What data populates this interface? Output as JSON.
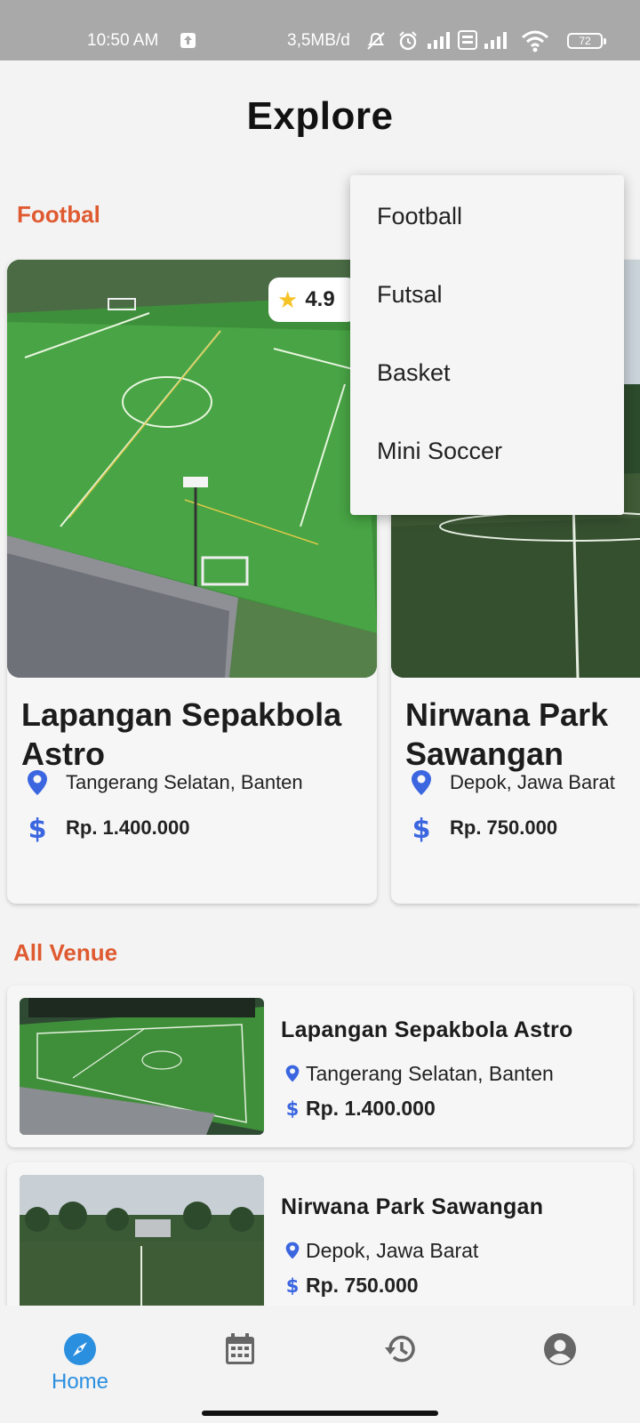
{
  "status_bar": {
    "time": "10:50 AM",
    "network_speed": "3,5MB/d",
    "battery": "72"
  },
  "header": {
    "title": "Explore"
  },
  "featured": {
    "section_label": "Footbal",
    "cards": [
      {
        "name": "Lapangan Sepakbola Astro",
        "rating": "4.9",
        "location": "Tangerang Selatan, Banten",
        "price": "Rp. 1.400.000"
      },
      {
        "name": "Nirwana Park Sawangan",
        "location": "Depok, Jawa Barat",
        "price": "Rp. 750.000"
      }
    ]
  },
  "all_venue": {
    "section_label": "All Venue",
    "items": [
      {
        "name": "Lapangan Sepakbola Astro",
        "location": "Tangerang Selatan, Banten",
        "price": "Rp. 1.400.000"
      },
      {
        "name": "Nirwana Park Sawangan",
        "location": "Depok, Jawa Barat",
        "price": "Rp. 750.000"
      }
    ]
  },
  "dropdown": {
    "items": [
      "Football",
      "Futsal",
      "Basket",
      "Mini Soccer"
    ]
  },
  "bottom_nav": {
    "home_label": "Home",
    "active": "home",
    "icons": [
      "compass-icon",
      "calendar-icon",
      "history-icon",
      "account-icon"
    ]
  },
  "colors": {
    "accent": "#df5a30",
    "primary_blue": "#2b8fe0",
    "pin_blue": "#3b66e0",
    "turf_green": "#3d8a3a"
  }
}
